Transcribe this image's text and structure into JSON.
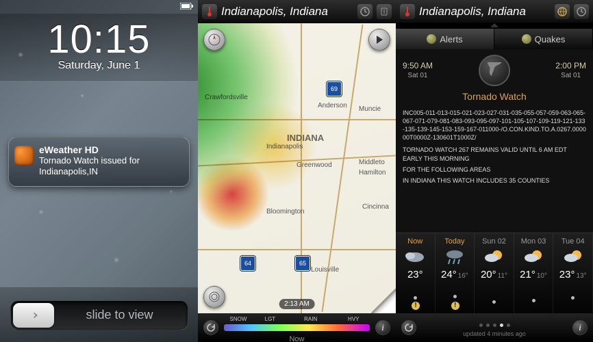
{
  "lock": {
    "time": "10:15",
    "date": "Saturday, June 1",
    "notif_title": "eWeather HD",
    "notif_body": "Tornado Watch issued for Indianapolis,IN",
    "slide": "slide to view"
  },
  "radar": {
    "location": "Indianapolis, Indiana",
    "state": "INDIANA",
    "cities": {
      "indianapolis": "Indianapolis",
      "anderson": "Anderson",
      "muncie": "Muncie",
      "greenwood": "Greenwood",
      "middletown": "Middleto",
      "hamilton": "Hamilton",
      "bloomington": "Bloomington",
      "cincinnati": "Cincinna",
      "louisville": "Louisville",
      "crawfordsville": "Crawfordsville"
    },
    "shields": {
      "i69": "69",
      "i65": "65",
      "i64": "64"
    },
    "frame_time": "2:13 AM",
    "legend": {
      "snow": "SNOW",
      "lgt": "LGT",
      "rain": "RAIN",
      "hvy": "HVY"
    },
    "nowtab": "Now"
  },
  "details": {
    "location": "Indianapolis, Indiana",
    "tabs": {
      "alerts": "Alerts",
      "quakes": "Quakes"
    },
    "start": {
      "time": "9:50 AM",
      "day": "Sat 01"
    },
    "end": {
      "time": "2:00 PM",
      "day": "Sat 01"
    },
    "title": "Tornado Watch",
    "codes": "INC005-011-013-015-021-023-027-031-035-055-057-059-063-065-067-071-079-081-083-093-095-097-101-105-107-109-119-121-133-135-139-145-153-159-167-011000-/O.CON.KIND.TO.A.0267.000000T0000Z-130601T1000Z/",
    "line1": "TORNADO WATCH 267 REMAINS VALID UNTIL 6 AM EDT EARLY THIS MORNING",
    "line2": "FOR THE FOLLOWING AREAS",
    "line3": "IN INDIANA THIS WATCH INCLUDES 35 COUNTIES",
    "forecast": [
      {
        "label": "Now",
        "hi": "23°",
        "lo": ""
      },
      {
        "label": "Today",
        "hi": "24°",
        "lo": "16°"
      },
      {
        "label": "Sun 02",
        "hi": "20°",
        "lo": "11°"
      },
      {
        "label": "Mon 03",
        "hi": "21°",
        "lo": "10°"
      },
      {
        "label": "Tue 04",
        "hi": "23°",
        "lo": "13°"
      }
    ],
    "updated": "updated 4 minutes ago"
  }
}
